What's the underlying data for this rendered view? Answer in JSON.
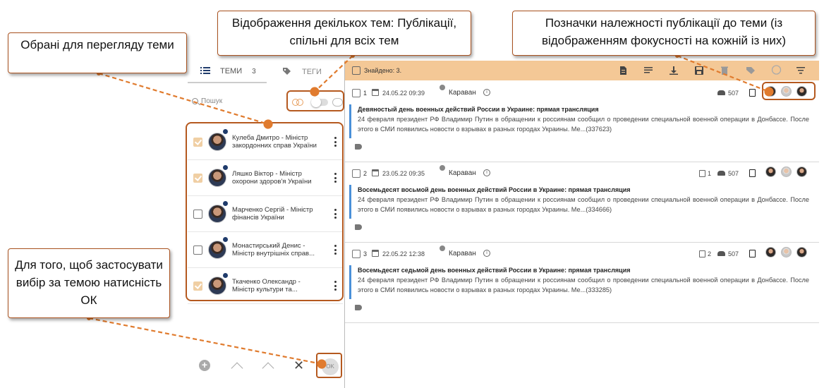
{
  "left_panel": {
    "tabs": [
      {
        "label": "ТЕМИ",
        "count": "3"
      },
      {
        "label": "ТЕГИ"
      }
    ],
    "search": {
      "placeholder": "Пошук"
    },
    "themes": [
      {
        "name": "Кулеба Дмитро - Міністр закордонних справ України",
        "checked": true
      },
      {
        "name": "Ляшко Віктор - Міністр охорони здоров'я України",
        "checked": true
      },
      {
        "name": "Марченко Сергій - Міністр фінансів України",
        "checked": false
      },
      {
        "name": "Монастирський Денис - Міністр внутрішніх справ...",
        "checked": false
      },
      {
        "name": "Ткаченко Олександр - Міністр культури та...",
        "checked": true
      }
    ],
    "ok_label": "OK"
  },
  "right_panel": {
    "found_label": "Знайдено: 3.",
    "accent": "#f4c896",
    "publications": [
      {
        "num": "1",
        "date": "24.05.22 09:39",
        "source": "Караван",
        "doc_count": "",
        "people": "507",
        "title": "Девяностый день военных действий России в Украине: прямая трансляция",
        "body": "24 февраля президент РФ Владимир Путин в обращении к россиянам сообщил о проведении специальной военной операции в Донбассе. После этого в СМИ появились новости о взрывах в разных городах Украины. Ме...(337623)"
      },
      {
        "num": "2",
        "date": "23.05.22 09:35",
        "source": "Караван",
        "doc_count": "1",
        "people": "507",
        "title": "Восемьдесят восьмой день военных действий России в Украине: прямая трансляция",
        "body": "24 февраля президент РФ Владимир Путин в обращении к россиянам сообщил о проведении специальной военной операции в Донбассе. После этого в СМИ появились новости о взрывах в разных городах Украины. Ме...(334666)"
      },
      {
        "num": "3",
        "date": "22.05.22 12:38",
        "source": "Караван",
        "doc_count": "2",
        "people": "507",
        "title": "Восемьдесят седьмой день военных действий России в Украине: прямая трансляция",
        "body": "24 февраля президент РФ Владимир Путин в обращении к россиянам сообщил о проведении специальной военной операции в Донбассе. После этого в СМИ появились новости о взрывах в разных городах Украины. Ме...(333285)"
      }
    ]
  },
  "callouts": {
    "selected_themes": "Обрані для перегляду теми",
    "multi_themes": "Відображення  декількох тем: Публікації, спільні для всіх тем",
    "theme_marks": "Позначки належності публікації до теми (із відображенням фокусності на кожній із них)",
    "press_ok": "Для того,  щоб застосувати вибір за темою натисність ОК"
  },
  "icons": [
    "list-icon",
    "tag-icon",
    "search-icon",
    "rings-icon",
    "toggle-switch",
    "plus-icon",
    "chevron-up-icon",
    "close-icon",
    "calendar-icon",
    "globe-icon",
    "info-icon",
    "people-icon",
    "document-icon",
    "tag-icon",
    "faces"
  ]
}
